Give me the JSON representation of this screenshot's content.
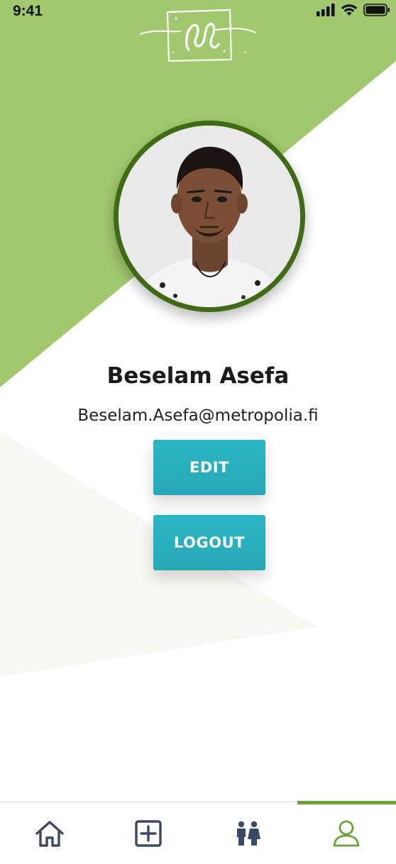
{
  "status_bar": {
    "time": "9:41"
  },
  "profile": {
    "name": "Beselam Asefa",
    "email": "Beselam.Asefa@metropolia.fi"
  },
  "actions": {
    "edit_label": "EDIT",
    "logout_label": "LOGOUT"
  },
  "bottom_nav": {
    "items": [
      {
        "icon": "home-icon",
        "active": false
      },
      {
        "icon": "add-square-icon",
        "active": false
      },
      {
        "icon": "people-icon",
        "active": false
      },
      {
        "icon": "user-icon",
        "active": true
      }
    ]
  },
  "colors": {
    "header_green": "#a1c76f",
    "avatar_ring": "#3f6b14",
    "button": "#2bb5c3",
    "nav_icon": "#3b4a63",
    "nav_active": "#6aa237",
    "background_shape": "#f7f8f3"
  }
}
